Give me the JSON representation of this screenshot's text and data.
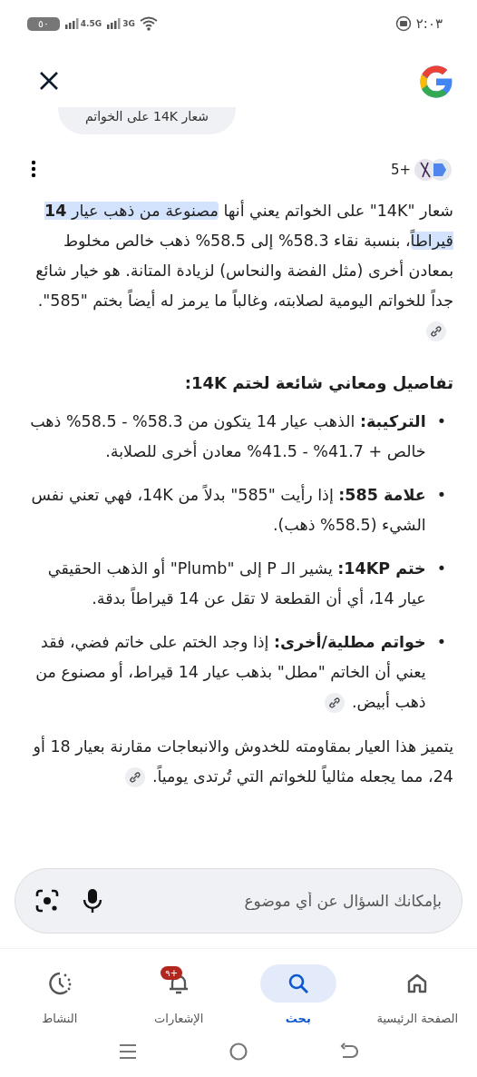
{
  "status_bar": {
    "battery": "٥٠",
    "networks": [
      "3G",
      "4.5G"
    ],
    "time": "٢:٠٣"
  },
  "query": {
    "text": "شعار 14K على الخواتم"
  },
  "answer": {
    "sources_count": "5+",
    "intro": [
      {
        "text": "شعار \"14K\" على الخواتم يعني أنها ",
        "highlighted": false
      },
      {
        "text": "مصنوعة من ذهب عيار **14** قيراطاً",
        "highlighted": true
      },
      {
        "text": "، بنسبة نقاء 58.3% إلى 58.5% ذهب خالص مخلوط بمعادن أخرى (مثل الفضة والنحاس) لزيادة المتانة. هو خيار شائع جداً للخواتم اليومية لصلابته، وغالباً ما يرمز له أيضاً بختم \"585\".",
        "highlighted": false
      }
    ],
    "intro_link": true,
    "heading": "تفاصيل ومعاني شائعة لختم 14K:",
    "bullets": [
      {
        "marker": "•",
        "text": "**التركيبة:** الذهب عيار 14 يتكون من 58.3% - 58.5% ذهب خالص + 41.7% - 41.5% معادن أخرى للصلابة.",
        "link": false
      },
      {
        "marker": "•",
        "text": "**علامة 585:** إذا رأيت \"585\" بدلاً من 14K، فهي تعني نفس الشيء (58.5% ذهب).",
        "link": false
      },
      {
        "marker": "•",
        "text": "**ختم 14KP:** يشير الـ P إلى \"Plumb\" أو الذهب الحقيقي عيار 14، أي أن القطعة لا تقل عن 14 قيراطاً بدقة.",
        "link": false
      },
      {
        "marker": "•",
        "text": "**خواتم مطلية/أخرى:** إذا وجد الختم على خاتم فضي، فقد يعني أن الخاتم \"مطل\" بذهب عيار 14 قيراط، أو مصنوع من ذهب أبيض.",
        "link": true
      }
    ],
    "closing": "يتميز هذا العيار بمقاومته للخدوش والانبعاجات مقارنة بعيار 18 أو 24، مما يجعله مثالياً للخواتم التي تُرتدى يومياً.",
    "closing_link": true
  },
  "search": {
    "placeholder": "بإمكانك السؤال عن أي موضوع"
  },
  "nav": [
    {
      "kind": "home",
      "label": "الصفحة الرئيسية",
      "selected": false
    },
    {
      "kind": "search",
      "label": "بحث",
      "selected": true
    },
    {
      "kind": "notifications",
      "label": "الإشعارات",
      "selected": false,
      "badge": "٩+"
    },
    {
      "kind": "activity",
      "label": "النشاط",
      "selected": false
    }
  ]
}
